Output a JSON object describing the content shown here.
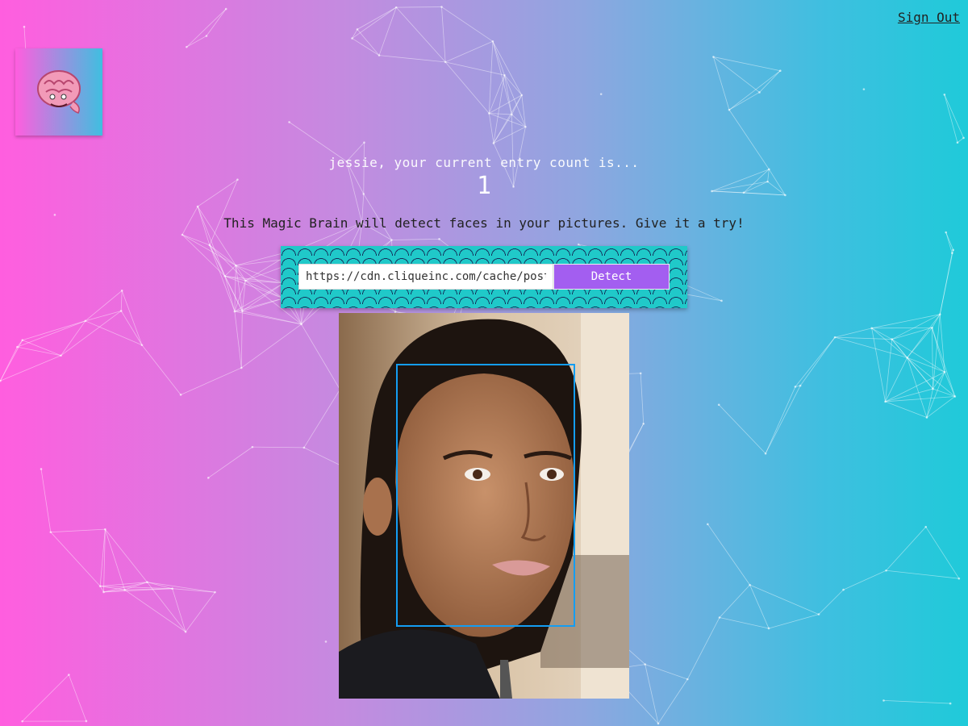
{
  "header": {
    "sign_out_label": "Sign Out"
  },
  "logo": {
    "icon": "brain-icon"
  },
  "rank": {
    "message": "jessie, your current entry count is...",
    "count": "1"
  },
  "intro": {
    "text": "This Magic Brain will detect faces in your pictures. Give it a try!"
  },
  "form": {
    "url_value": "https://cdn.cliqueinc.com/cache/posts/",
    "detect_label": "Detect"
  },
  "face_detection": {
    "face_count": 1
  },
  "colors": {
    "gradient_left": "#ff5edf",
    "gradient_right": "#1fcad9",
    "detect_button": "#a35ef0",
    "panel_teal": "#20c9c9",
    "bounding_box": "#149df2"
  }
}
